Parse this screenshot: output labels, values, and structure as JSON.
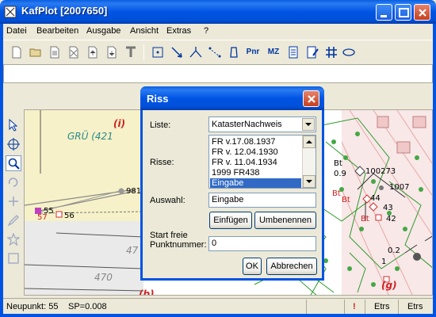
{
  "window": {
    "title": "KafPlot [2007650]"
  },
  "menu": [
    "Datei",
    "Bearbeiten",
    "Ausgabe",
    "Ansicht",
    "Extras",
    "?"
  ],
  "toolbar": {
    "pnr_label": "Pnr",
    "mz_label": "MZ"
  },
  "map": {
    "labels": {
      "i": "(i)",
      "gru": "GRÜ (421",
      "n981": "981",
      "n55": "55",
      "n56": "56",
      "n47": "47",
      "n470": "470",
      "b": "(b)",
      "bt1": "Bt",
      "n09": "0.9",
      "n100273": "100273",
      "n1007": "1007",
      "bt2": "Bt",
      "bt3": "Bt",
      "n44": "44",
      "n43": "43",
      "n42": "42",
      "bt4": "Bt",
      "n02": "0.2",
      "g": "(g)",
      "n1": "1",
      "n57": "57"
    }
  },
  "dialog": {
    "title": "Riss",
    "liste_label": "Liste:",
    "liste_value": "KatasterNachweis",
    "risse_label": "Risse:",
    "risse_items": [
      "FR v.17.08.1937",
      "FR v. 12.04.1930",
      "FR v. 11.04.1934",
      "1999 FR438",
      "Eingabe"
    ],
    "auswahl_label": "Auswahl:",
    "auswahl_value": "Eingabe",
    "einfuegen": "Einfügen",
    "umbenennen": "Umbenennen",
    "start_label_1": "Start freie",
    "start_label_2": "Punktnummer:",
    "start_value": "0",
    "ok": "OK",
    "abbrechen": "Abbrechen"
  },
  "status": {
    "neupunkt": "Neupunkt: 55",
    "sp": "SP=0.008",
    "alert": "!",
    "etrs1": "Etrs",
    "etrs2": "Etrs"
  }
}
